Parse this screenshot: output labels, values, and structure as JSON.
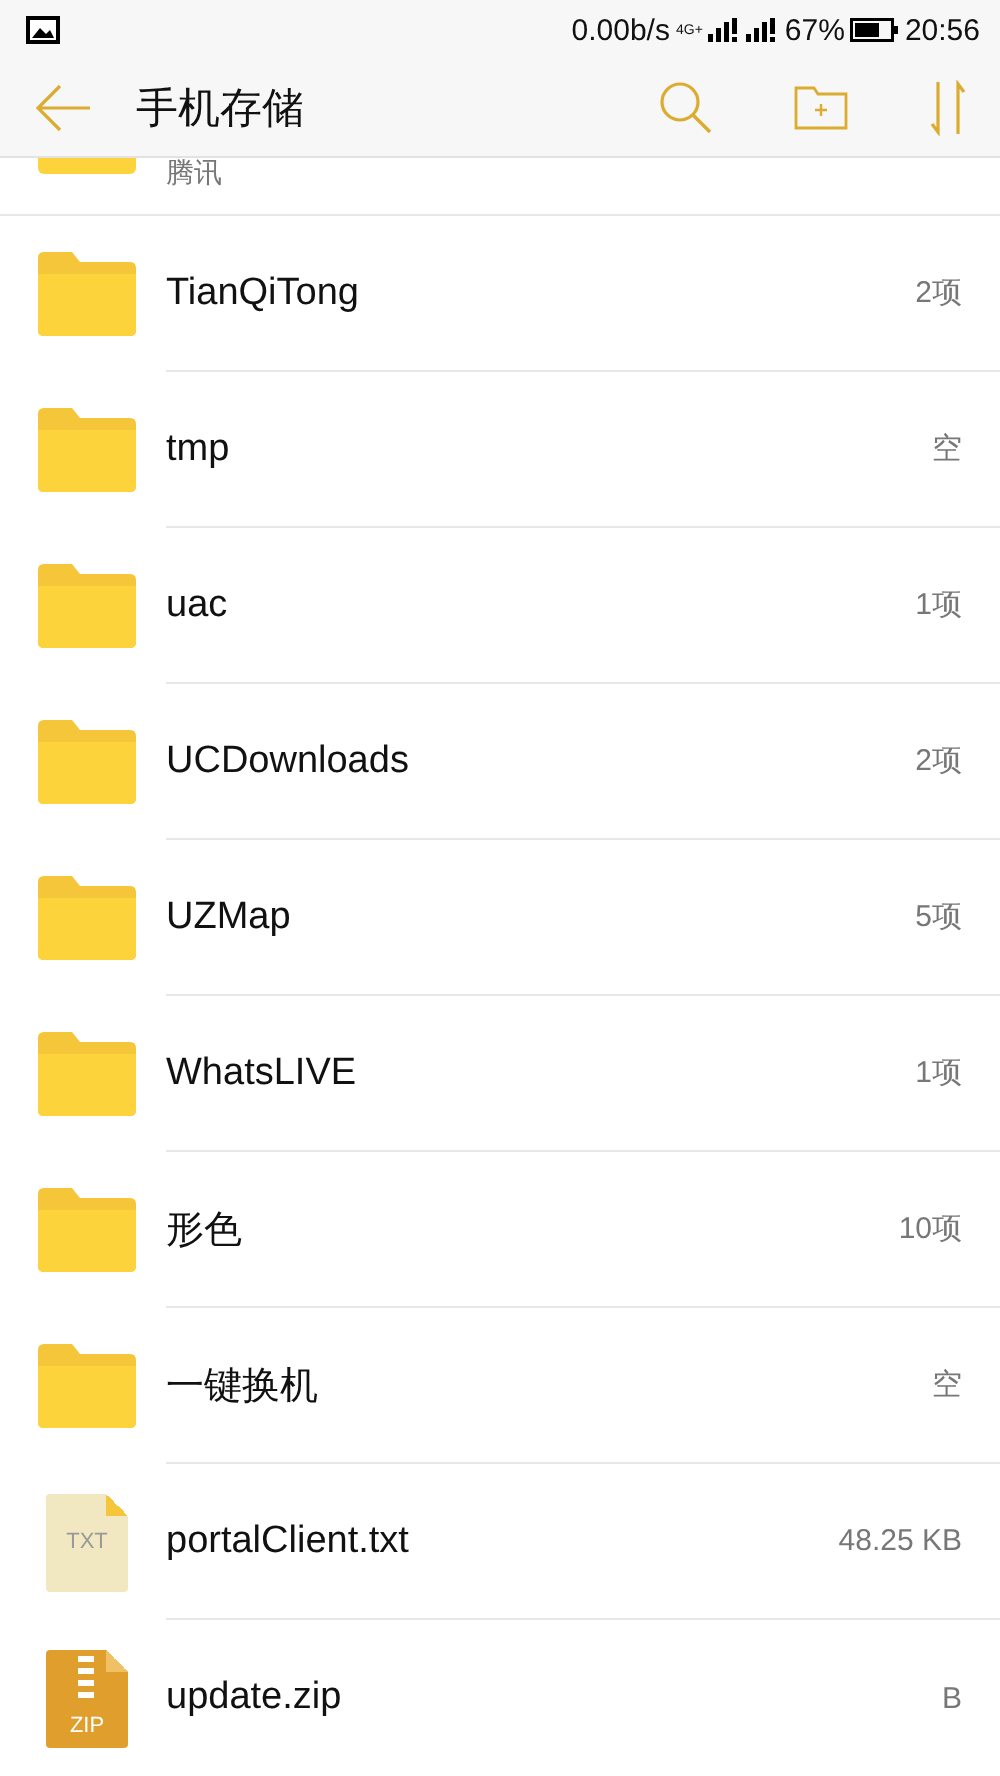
{
  "status_bar": {
    "speed": "0.00b/s",
    "network": "4G+",
    "battery": "67%",
    "time": "20:56"
  },
  "toolbar": {
    "title": "手机存储"
  },
  "partial_row": {
    "name": "腾讯"
  },
  "files": [
    {
      "kind": "folder",
      "name": "TianQiTong",
      "info": "2项"
    },
    {
      "kind": "folder",
      "name": "tmp",
      "info": "空"
    },
    {
      "kind": "folder",
      "name": "uac",
      "info": "1项"
    },
    {
      "kind": "folder",
      "name": "UCDownloads",
      "info": "2项"
    },
    {
      "kind": "folder",
      "name": "UZMap",
      "info": "5项"
    },
    {
      "kind": "folder",
      "name": "WhatsLIVE",
      "info": "1项"
    },
    {
      "kind": "folder",
      "name": "形色",
      "info": "10项"
    },
    {
      "kind": "folder",
      "name": "一键换机",
      "info": "空"
    },
    {
      "kind": "txt",
      "name": "portalClient.txt",
      "info": "48.25 KB",
      "icon_label": "TXT"
    },
    {
      "kind": "zip",
      "name": "update.zip",
      "info": "B",
      "icon_label": "ZIP"
    }
  ]
}
